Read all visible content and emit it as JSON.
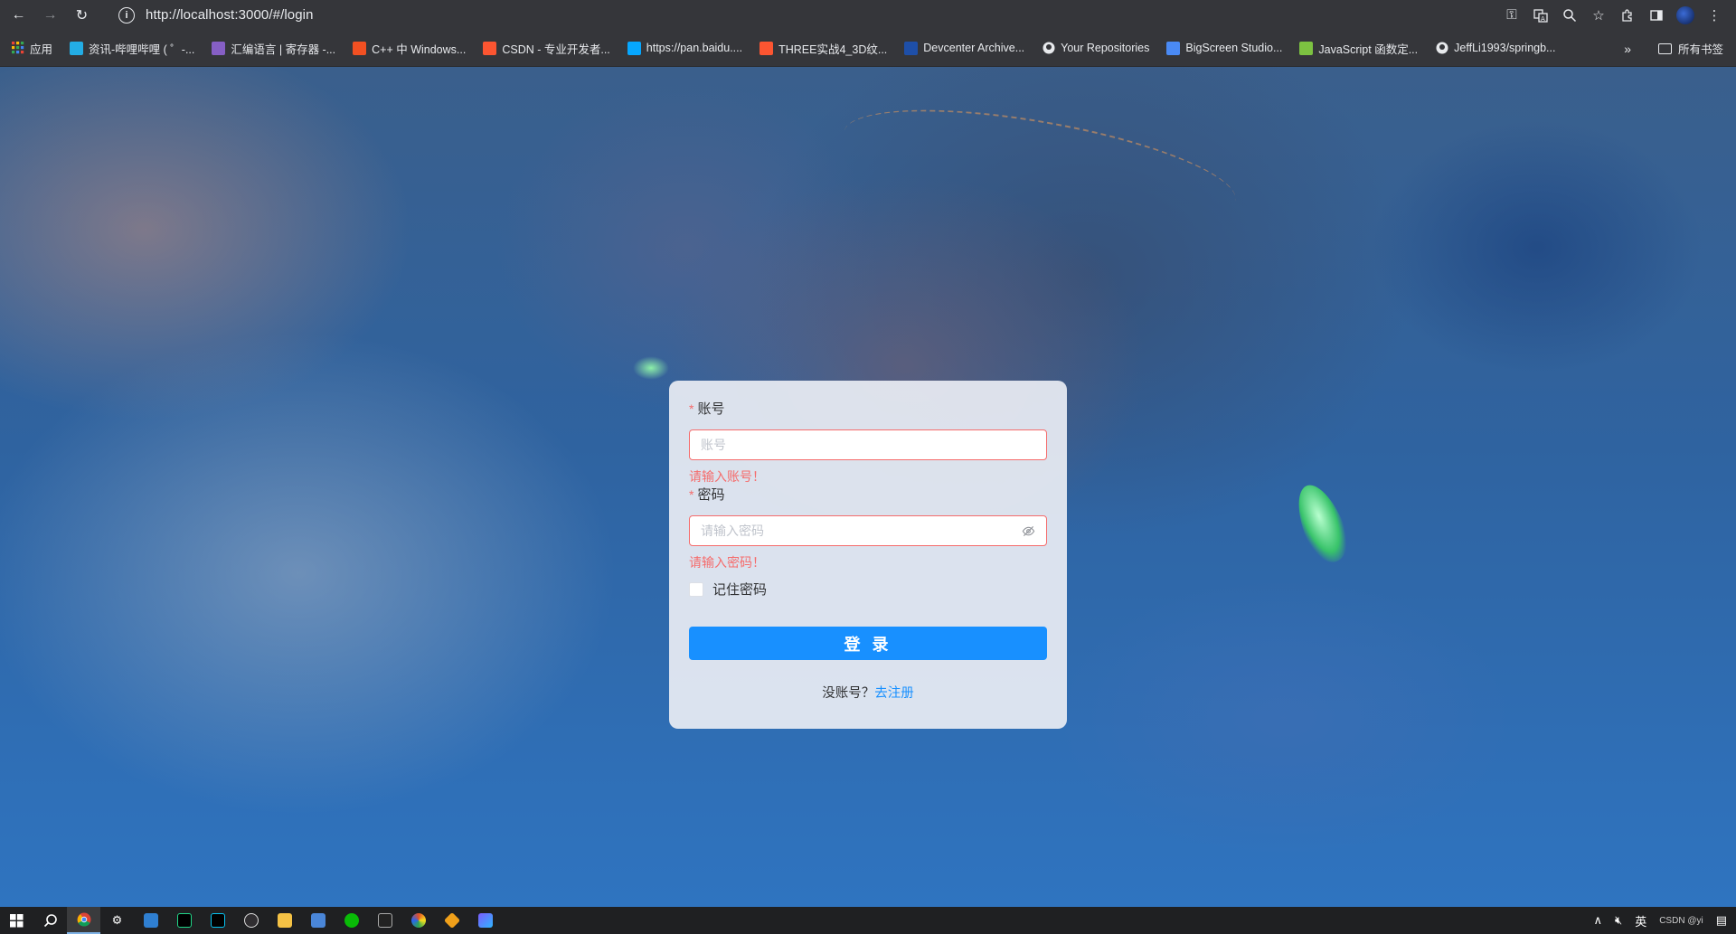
{
  "browser": {
    "url": "http://localhost:3000/#/login",
    "nav": {
      "back": "←",
      "forward": "→",
      "reload": "↻"
    },
    "right_icons": [
      "key-icon",
      "translate-icon",
      "zoom-icon",
      "star-icon",
      "extensions-icon",
      "sidepanel-icon",
      "profile-icon",
      "menu-icon"
    ]
  },
  "bookmarks": {
    "items": [
      {
        "label": "应用",
        "icon": "apps-icon",
        "color": "#e8eaed"
      },
      {
        "label": "资讯-哔哩哔哩 ( ゜-...",
        "icon": "bilibili-icon",
        "color": "#23ade5"
      },
      {
        "label": "汇编语言 | 寄存器 -...",
        "icon": "vs-icon",
        "color": "#865fc5"
      },
      {
        "label": "C++ 中 Windows...",
        "icon": "microsoft-icon",
        "color": "#f25022"
      },
      {
        "label": "CSDN - 专业开发者...",
        "icon": "csdn-icon",
        "color": "#fc5531"
      },
      {
        "label": "https://pan.baidu....",
        "icon": "baidu-pan-icon",
        "color": "#06a7ff"
      },
      {
        "label": "THREE实战4_3D纹...",
        "icon": "csdn-icon",
        "color": "#fc5531"
      },
      {
        "label": "Devcenter Archive...",
        "icon": "w-icon",
        "color": "#1e4fa8"
      },
      {
        "label": "Your Repositories",
        "icon": "github-icon",
        "color": "#e8eaed"
      },
      {
        "label": "BigScreen Studio...",
        "icon": "bigscreen-icon",
        "color": "#4a8af4"
      },
      {
        "label": "JavaScript 函数定...",
        "icon": "runoob-icon",
        "color": "#7cc241"
      },
      {
        "label": "JeffLi1993/springb...",
        "icon": "github-icon",
        "color": "#e8eaed"
      }
    ],
    "more": "»",
    "all_bookmarks": "所有书签"
  },
  "login": {
    "account_label": "账号",
    "account_placeholder": "账号",
    "account_error": "请输入账号！",
    "password_label": "密码",
    "password_placeholder": "请输入密码",
    "password_error": "请输入密码！",
    "required_mark": "*",
    "remember_label": "记住密码",
    "login_button": "登 录",
    "no_account_text": "没账号？",
    "register_link": "去注册",
    "colors": {
      "primary": "#1890ff",
      "error": "#f56c6c"
    }
  },
  "taskbar": {
    "apps": [
      "windows-start-icon",
      "search-icon",
      "chrome-icon",
      "settings-icon",
      "control-panel-icon",
      "pycharm-icon",
      "webstorm-icon",
      "obs-icon",
      "file-explorer-icon",
      "app-icon",
      "wechat-icon",
      "terminal-icon",
      "browser-icon",
      "git-icon",
      "image-viewer-icon"
    ],
    "tray": {
      "ime": "英",
      "watermark": "CSDN @yi"
    }
  }
}
